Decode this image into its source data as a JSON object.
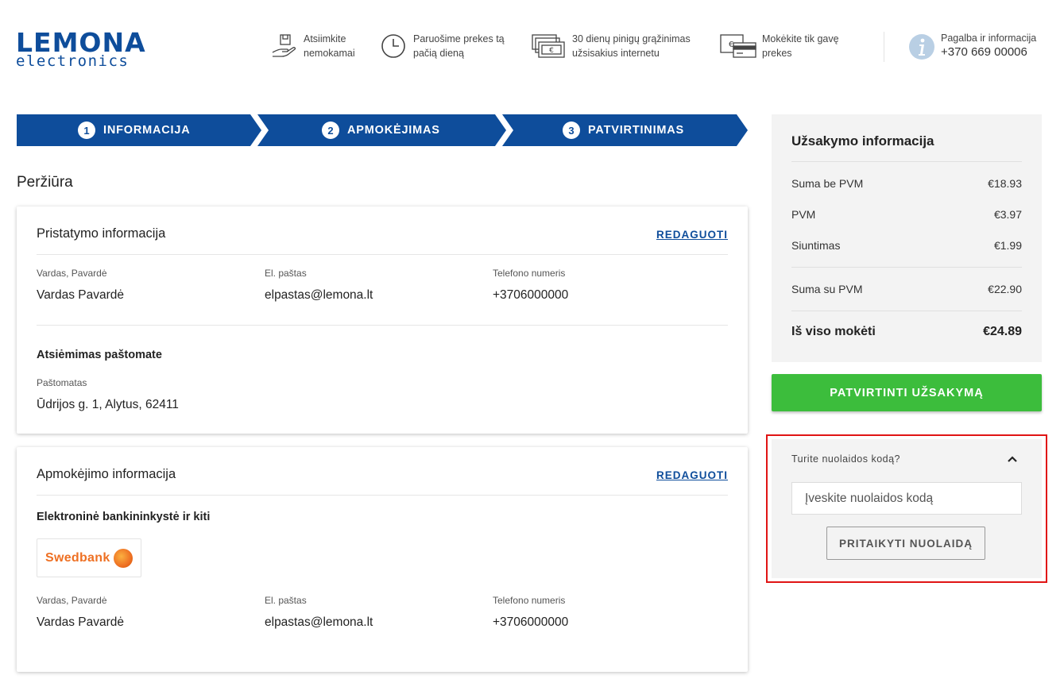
{
  "header": {
    "logo": {
      "brand": "LEMONA",
      "sub": "electronics"
    },
    "usps": [
      {
        "icon": "hand-box-icon",
        "line1": "Atsiimkite",
        "line2": "nemokamai"
      },
      {
        "icon": "clock-icon",
        "line1": "Paruošime prekes tą",
        "line2": "pačią dieną"
      },
      {
        "icon": "money-icon",
        "line1": "30 dienų pinigų grąžinimas",
        "line2": "užsisakius internetu"
      },
      {
        "icon": "wallet-card-icon",
        "line1": "Mokėkite tik gavę",
        "line2": "prekes"
      }
    ],
    "help": {
      "label": "Pagalba ir informacija",
      "phone": "+370 669 00006"
    }
  },
  "steps": [
    {
      "num": "1",
      "label": "INFORMACIJA"
    },
    {
      "num": "2",
      "label": "APMOKĖJIMAS"
    },
    {
      "num": "3",
      "label": "PATVIRTINIMAS"
    }
  ],
  "section_title": "Peržiūra",
  "delivery": {
    "title": "Pristatymo informacija",
    "edit_label": "REDAGUOTI",
    "name_label": "Vardas, Pavardė",
    "name_value": "Vardas Pavardė",
    "email_label": "El. paštas",
    "email_value": "elpastas@lemona.lt",
    "phone_label": "Telefono numeris",
    "phone_value": "+3706000000",
    "method_title": "Atsiėmimas paštomate",
    "locker_label": "Paštomatas",
    "locker_value": "Ūdrijos g. 1, Alytus, 62411"
  },
  "payment": {
    "title": "Apmokėjimo informacija",
    "edit_label": "REDAGUOTI",
    "method_title": "Elektroninė bankininkystė ir kiti",
    "bank_name": "Swedbank",
    "name_label": "Vardas, Pavardė",
    "name_value": "Vardas Pavardė",
    "email_label": "El. paštas",
    "email_value": "elpastas@lemona.lt",
    "phone_label": "Telefono numeris",
    "phone_value": "+3706000000"
  },
  "summary": {
    "title": "Užsakymo informacija",
    "rows": [
      {
        "label": "Suma be PVM",
        "value": "€18.93"
      },
      {
        "label": "PVM",
        "value": "€3.97"
      },
      {
        "label": "Siuntimas",
        "value": "€1.99"
      },
      {
        "label": "Suma su PVM",
        "value": "€22.90"
      }
    ],
    "total_label": "Iš viso mokėti",
    "total_value": "€24.89"
  },
  "confirm_label": "PATVIRTINTI UŽSAKYMĄ",
  "discount": {
    "question": "Turite nuolaidos kodą?",
    "placeholder": "Įveskite nuolaidos kodą",
    "apply_label": "PRITAIKYTI NUOLAIDĄ"
  },
  "colors": {
    "brand_blue": "#0e4d9b",
    "confirm_green": "#3cbd3c",
    "highlight_red": "#e01414"
  }
}
